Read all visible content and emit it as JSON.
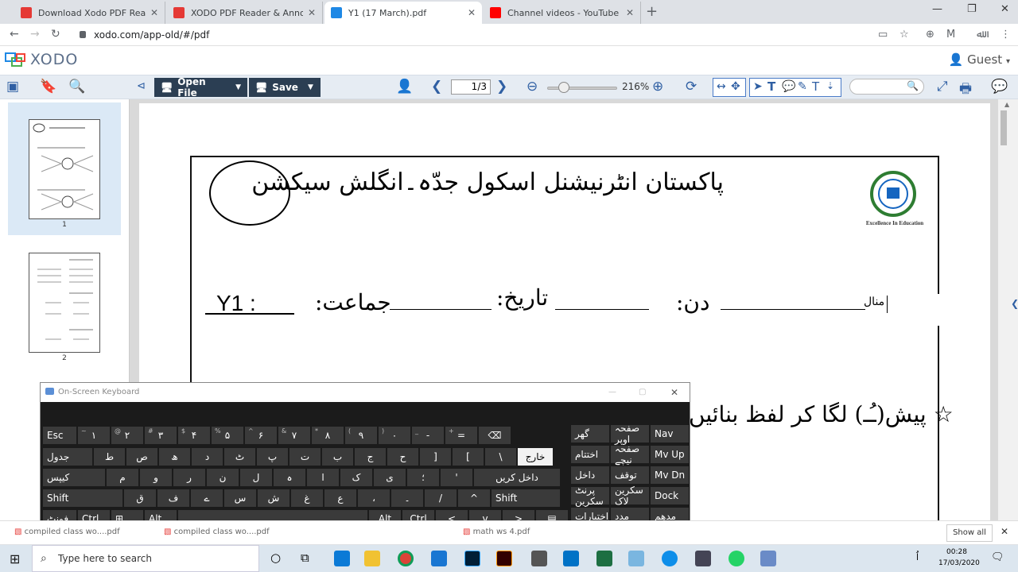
{
  "tabs": [
    {
      "label": "Download Xodo PDF Reader & E",
      "color": "#e53935"
    },
    {
      "label": "XODO PDF Reader & Annotator",
      "color": "#e53935"
    },
    {
      "label": "Y1 (17 March).pdf",
      "color": "#1e88e5"
    },
    {
      "label": "Channel videos - YouTube Studio",
      "color": "#ff0000"
    }
  ],
  "address": {
    "url": "xodo.com/app-old/#/pdf"
  },
  "app": {
    "logo": "XODO",
    "user": "Guest"
  },
  "toolbar": {
    "open_label": "Open File",
    "save_label": "Save",
    "page_value": "1",
    "page_total": "/3",
    "zoom": "216%"
  },
  "thumbs": [
    "1",
    "2"
  ],
  "doc": {
    "title": "پاکستان انٹرنیشنل اسکول جدّہ۔انگلش سیکشن",
    "motto": "Excellence In Education",
    "class_label": "جماعت:",
    "class_value": "Y1 :",
    "date_label": "تاریخ:",
    "day_label": "دن:",
    "name_fragment": "منال",
    "exercise": "☆ پیش(ـُـ) لگا کر لفظ بنائیں"
  },
  "osk": {
    "title": "On-Screen Keyboard",
    "row1": [
      "Esc",
      "۱",
      "۲",
      "۳",
      "۴",
      "۵",
      "۶",
      "۷",
      "۸",
      "۹",
      "۰",
      "-",
      "=",
      "⌫"
    ],
    "row1_small": [
      "",
      "~",
      "@",
      "#",
      "$",
      "%",
      "^",
      "&",
      "*",
      "(",
      ")",
      "_",
      "+",
      ""
    ],
    "row2": [
      "جدول",
      "ط",
      "ص",
      "ھ",
      "د",
      "ٹ",
      "پ",
      "ت",
      "ب",
      "ج",
      "ح",
      "]",
      "[",
      "\\",
      "خارج"
    ],
    "row3": [
      "کیپس",
      "م",
      "و",
      "ر",
      "ن",
      "ل",
      "ہ",
      "ا",
      "ک",
      "ی",
      "؛",
      "'",
      "داخل کریں"
    ],
    "row4": [
      "Shift",
      "ق",
      "ف",
      "ے",
      "س",
      "ش",
      "غ",
      "ع",
      "،",
      "۔",
      "/",
      "^",
      "Shift"
    ],
    "row5": [
      "فونٹ",
      "Ctrl",
      "⊞",
      "Alt",
      "",
      "Alt",
      "Ctrl",
      "<",
      "v",
      ">",
      "▤"
    ],
    "nav": [
      "گھر",
      "صفحہ اوپر",
      "Nav",
      "اختتام",
      "صفحہ نیچے",
      "Mv Up",
      "داخل",
      "توقف",
      "Mv Dn",
      "پرنٹ سکرین",
      "سکرین لاک",
      "Dock",
      "اختیارات",
      "مدد",
      "مدھم"
    ]
  },
  "downloads": [
    "compiled class wo....pdf",
    "compiled class wo....pdf",
    "math ws 4.pdf"
  ],
  "downloads_showall": "Show all",
  "taskbar": {
    "search": "Type here to search",
    "time": "00:28",
    "date": "17/03/2020"
  }
}
